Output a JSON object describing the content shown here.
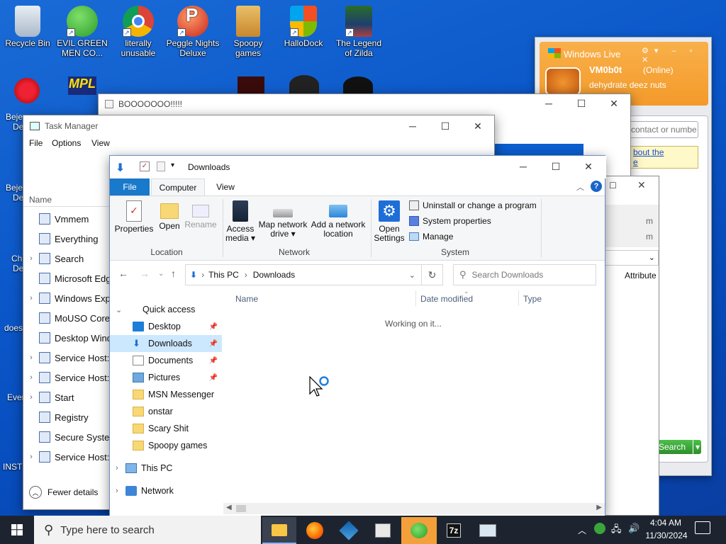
{
  "desktop": {
    "icons": [
      {
        "label": "Recycle Bin"
      },
      {
        "label": "EVIL GREEN MEN CO..."
      },
      {
        "label": "literally unusable"
      },
      {
        "label": "Peggle Nights Deluxe"
      },
      {
        "label": "Spoopy games"
      },
      {
        "label": "HalloDock"
      },
      {
        "label": "The Legend of Zilda"
      }
    ],
    "left_partial": [
      "Beje",
      "De",
      "Beje",
      "De",
      "Ch",
      "De",
      "does",
      "Ever",
      "INST"
    ]
  },
  "booooo_window": {
    "title": "BOOOOOOO!!!!!"
  },
  "msn": {
    "title": "Windows Live",
    "username": "VM0b0t",
    "status": "(Online)",
    "personal_message": "dehydrate deez nuts",
    "search_placeholder": "contact or numbe",
    "link_text_1": "bout the",
    "link_text_2": "e",
    "search_button": "Search"
  },
  "task_manager": {
    "title": "Task Manager",
    "menu": [
      "File",
      "Options",
      "View"
    ],
    "column_name": "Name",
    "processes": [
      {
        "name": "Vmmem",
        "expandable": false
      },
      {
        "name": "Everything",
        "expandable": false
      },
      {
        "name": "Search",
        "expandable": true
      },
      {
        "name": "Microsoft Edg",
        "expandable": false
      },
      {
        "name": "Windows Exp",
        "expandable": true
      },
      {
        "name": "MoUSO Core",
        "expandable": false
      },
      {
        "name": "Desktop Wind",
        "expandable": false
      },
      {
        "name": "Service Host:",
        "expandable": true
      },
      {
        "name": "Service Host:",
        "expandable": true
      },
      {
        "name": "Start",
        "expandable": true
      },
      {
        "name": "Registry",
        "expandable": false
      },
      {
        "name": "Secure Syster",
        "expandable": false
      },
      {
        "name": "Service Host:",
        "expandable": true
      }
    ],
    "fewer_details": "Fewer details"
  },
  "back_window": {
    "partial_rows": [
      "m",
      "m"
    ],
    "attribute_col": "Attribute"
  },
  "explorer": {
    "title": "Downloads",
    "tabs": [
      "File",
      "Computer",
      "View"
    ],
    "ribbon": {
      "properties": "Properties",
      "open": "Open",
      "rename": "Rename",
      "access_media": "Access media ▾",
      "map_network_drive": "Map network drive ▾",
      "add_network_location": "Add a network location",
      "open_settings": "Open Settings",
      "uninstall": "Uninstall or change a program",
      "system_properties": "System properties",
      "manage": "Manage",
      "group_location": "Location",
      "group_network": "Network",
      "group_system": "System"
    },
    "address": {
      "root": "This PC",
      "current": "Downloads"
    },
    "search_placeholder": "Search Downloads",
    "columns": [
      "Name",
      "Date modified",
      "Type"
    ],
    "status_text": "Working on it...",
    "nav": {
      "quick_access": "Quick access",
      "pinned": [
        "Desktop",
        "Downloads",
        "Documents",
        "Pictures"
      ],
      "folders": [
        "MSN Messenger",
        "onstar",
        "Scary Shit",
        "Spoopy games"
      ],
      "this_pc": "This PC",
      "network": "Network"
    }
  },
  "taskbar": {
    "search_placeholder": "Type here to search",
    "time": "4:04 AM",
    "date": "11/30/2024"
  }
}
